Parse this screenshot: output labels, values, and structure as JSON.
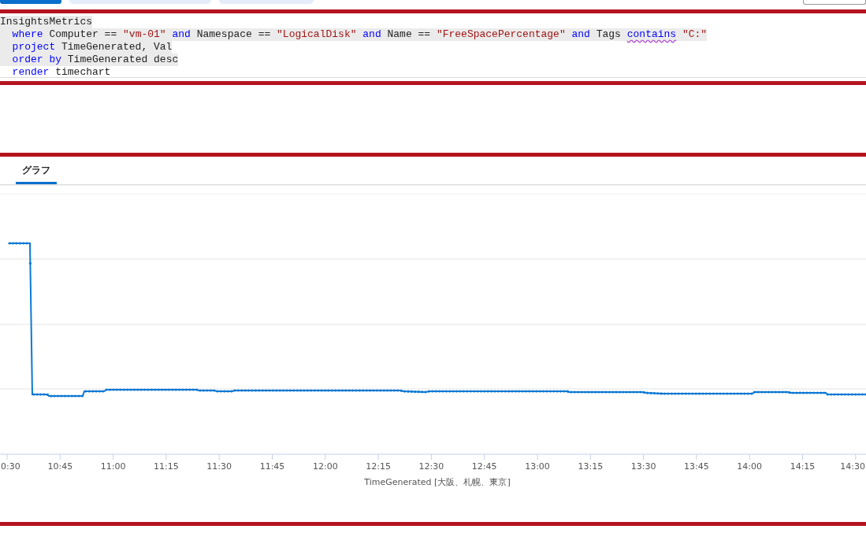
{
  "top_bar": {
    "buttons": [
      {
        "selected": true
      },
      {
        "selected": false
      },
      {
        "selected": false
      }
    ]
  },
  "query_editor": {
    "lines": [
      {
        "selected": true,
        "indented": false,
        "tokens": [
          {
            "kind": "plain",
            "text": "InsightsMetrics"
          }
        ]
      },
      {
        "selected": true,
        "indented": true,
        "tokens": [
          {
            "kind": "keyword",
            "text": "where"
          },
          {
            "kind": "plain",
            "text": "Computer ==",
            "space": true
          },
          {
            "kind": "string",
            "text": "\"vm-01\"",
            "space": true
          },
          {
            "kind": "keyword",
            "text": "and",
            "space": true
          },
          {
            "kind": "plain",
            "text": "Namespace ==",
            "space": true
          },
          {
            "kind": "string",
            "text": "\"LogicalDisk\"",
            "space": true
          },
          {
            "kind": "keyword",
            "text": "and",
            "space": true
          },
          {
            "kind": "plain",
            "text": "Name ==",
            "space": true
          },
          {
            "kind": "string",
            "text": "\"FreeSpacePercentage\"",
            "space": true
          },
          {
            "kind": "keyword",
            "text": "and",
            "space": true
          },
          {
            "kind": "plain",
            "text": "Tags",
            "space": true
          },
          {
            "kind": "keyword",
            "text": "contains",
            "space": true,
            "flagged": true
          },
          {
            "kind": "string",
            "text": "\"C:\"",
            "space": true
          }
        ]
      },
      {
        "selected": true,
        "indented": true,
        "tokens": [
          {
            "kind": "keyword",
            "text": "project"
          },
          {
            "kind": "plain",
            "text": "TimeGenerated, Val",
            "space": true
          }
        ]
      },
      {
        "selected": true,
        "indented": true,
        "tokens": [
          {
            "kind": "keyword",
            "text": "order by"
          },
          {
            "kind": "plain",
            "text": "TimeGenerated desc",
            "space": true
          }
        ]
      },
      {
        "selected": false,
        "indented": true,
        "tokens": [
          {
            "kind": "keyword",
            "text": "render"
          },
          {
            "kind": "plain",
            "text": "timechart",
            "space": true
          }
        ]
      }
    ]
  },
  "results": {
    "tabs": [
      {
        "label": "グラフ",
        "selected": true
      }
    ],
    "chart": {
      "x_ticks": [
        "0:30",
        "10:45",
        "11:00",
        "11:15",
        "11:30",
        "11:45",
        "12:00",
        "12:15",
        "12:30",
        "12:45",
        "13:00",
        "13:15",
        "13:30",
        "13:45",
        "14:00",
        "14:15",
        "14:30"
      ],
      "x_axis_title": "TimeGenerated [大阪、札幌、東京]"
    }
  }
}
